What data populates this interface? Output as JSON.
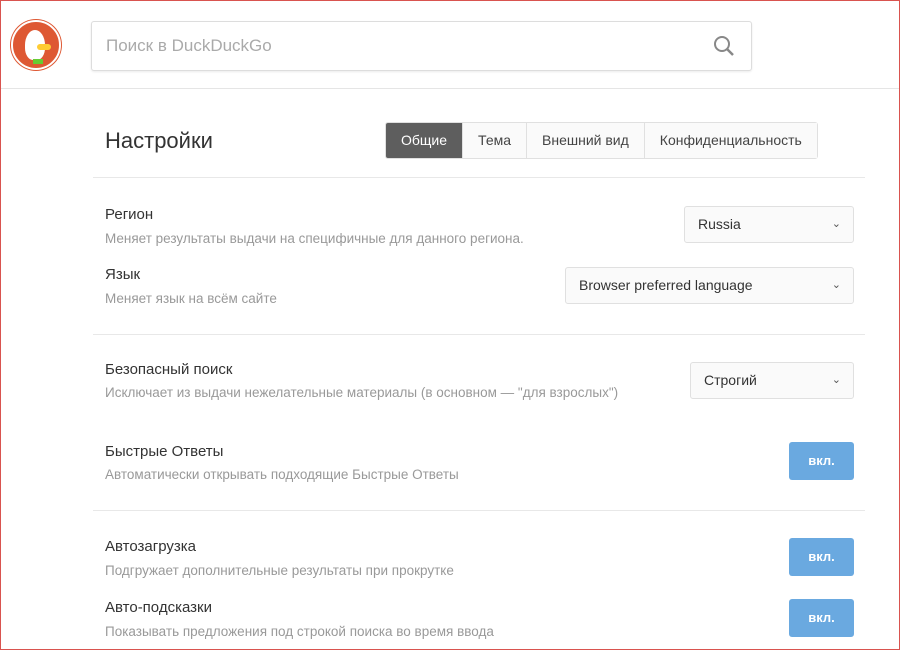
{
  "search": {
    "placeholder": "Поиск в DuckDuckGo"
  },
  "page_title": "Настройки",
  "tabs": [
    "Общие",
    "Тема",
    "Внешний вид",
    "Конфиденциальность"
  ],
  "settings": {
    "region": {
      "label": "Регион",
      "desc": "Меняет результаты выдачи на специфичные для данного региона.",
      "value": "Russia"
    },
    "language": {
      "label": "Язык",
      "desc": "Меняет язык на всём сайте",
      "value": "Browser preferred language"
    },
    "safe_search": {
      "label": "Безопасный поиск",
      "desc": "Исключает из выдачи нежелательные материалы (в основном — \"для взрослых\")",
      "value": "Строгий"
    },
    "instant_answers": {
      "label": "Быстрые Ответы",
      "desc": "Автоматически открывать подходящие Быстрые Ответы",
      "value": "вкл."
    },
    "infinite_scroll": {
      "label": "Автозагрузка",
      "desc": "Подгружает дополнительные результаты при прокрутке",
      "value": "вкл."
    },
    "autosuggest": {
      "label": "Авто-подсказки",
      "desc": "Показывать предложения под строкой поиска во время ввода",
      "value": "вкл."
    }
  },
  "colors": {
    "accent": "#6aa9e0",
    "logo": "#de5833",
    "active_tab": "#5e5e5e"
  }
}
